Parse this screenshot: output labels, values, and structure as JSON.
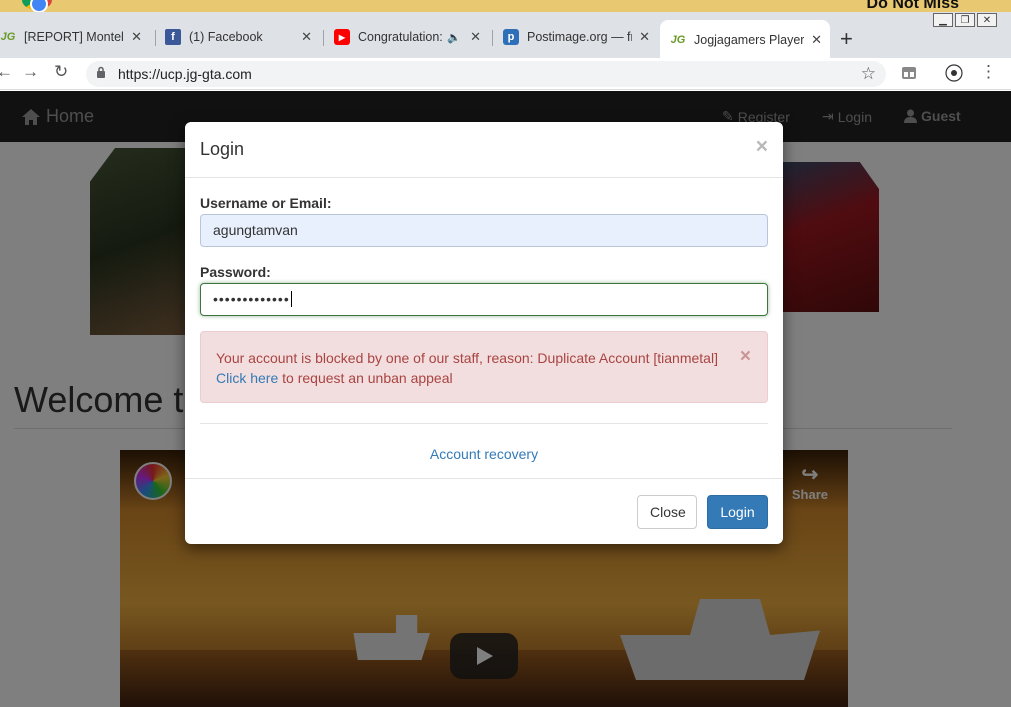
{
  "top_banner": {
    "text": "Do Not Miss"
  },
  "tabs": [
    {
      "title": "[REPORT] Montelso",
      "favicon": "jg-logo-icon"
    },
    {
      "title": "(1) Facebook",
      "favicon": "facebook-icon"
    },
    {
      "title": "Congratulation:",
      "favicon": "youtube-icon",
      "audio": "speaker-icon"
    },
    {
      "title": "Postimage.org — fr",
      "favicon": "postimage-icon"
    },
    {
      "title": "Jogjagamers Player",
      "favicon": "jg-logo-icon",
      "active": true
    }
  ],
  "address_bar": {
    "url": "https://ucp.jg-gta.com"
  },
  "site_nav": {
    "home": "Home",
    "register": "Register",
    "login": "Login",
    "guest": "Guest"
  },
  "page": {
    "welcome": "Welcome t",
    "video_share": "Share"
  },
  "modal": {
    "title": "Login",
    "close_glyph": "×",
    "username_label": "Username or Email:",
    "username_value": "agungtamvan",
    "password_label": "Password:",
    "password_value": "•••••••••••••",
    "alert_text": "Your account is blocked by one of our staff, reason: Duplicate Account [tianmetal]",
    "alert_link": "Click here",
    "alert_suffix": " to request an unban appeal",
    "alert_close": "×",
    "recovery_link": "Account recovery",
    "close_button": "Close",
    "login_button": "Login"
  },
  "colors": {
    "navbar_bg": "#222222",
    "alert_bg": "#f2dede",
    "alert_text": "#a94442",
    "link": "#337ab7",
    "primary_button": "#337ab7",
    "focus_border": "#3c763d"
  }
}
